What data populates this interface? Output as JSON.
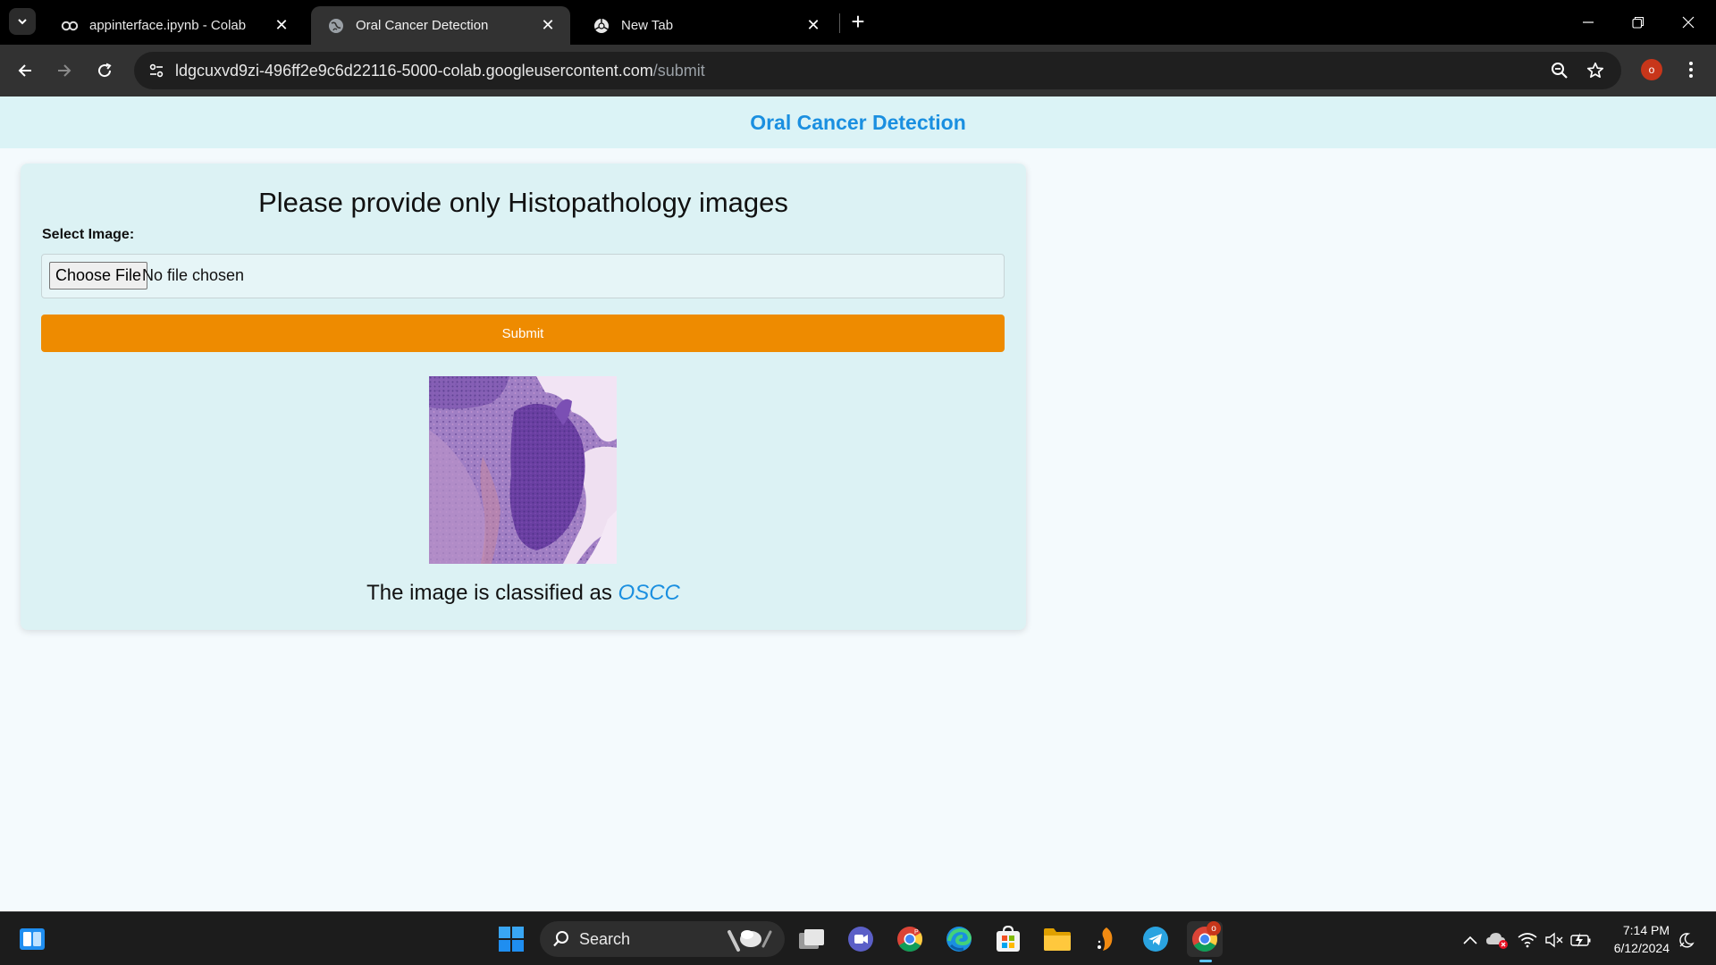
{
  "browser": {
    "tabs": [
      {
        "title": "appinterface.ipynb - Colab",
        "icon": "colab-icon",
        "active": false
      },
      {
        "title": "Oral Cancer Detection",
        "icon": "globe-icon",
        "active": true
      },
      {
        "title": "New Tab",
        "icon": "chrome-icon",
        "active": false
      }
    ],
    "url_host": "ldgcuxvd9zi-496ff2e9c6d22116-5000-colab.googleusercontent.com",
    "url_path": "/submit",
    "profile_initial": "o"
  },
  "app": {
    "title": "Oral Cancer Detection",
    "heading": "Please provide only Histopathology images",
    "select_label": "Select Image:",
    "choose_file_label": "Choose File",
    "file_status": "No file chosen",
    "submit_label": "Submit",
    "result_prefix": "The image is classified as",
    "result_class": "OSCC"
  },
  "taskbar": {
    "search_label": "Search",
    "time": "7:14 PM",
    "date": "6/12/2024",
    "chrome_badge": "o"
  },
  "colors": {
    "accent_blue": "#1a8fe0",
    "submit_orange": "#ee8b00",
    "header_bg": "#dbf3f6",
    "card_bg": "#dcf2f4"
  }
}
